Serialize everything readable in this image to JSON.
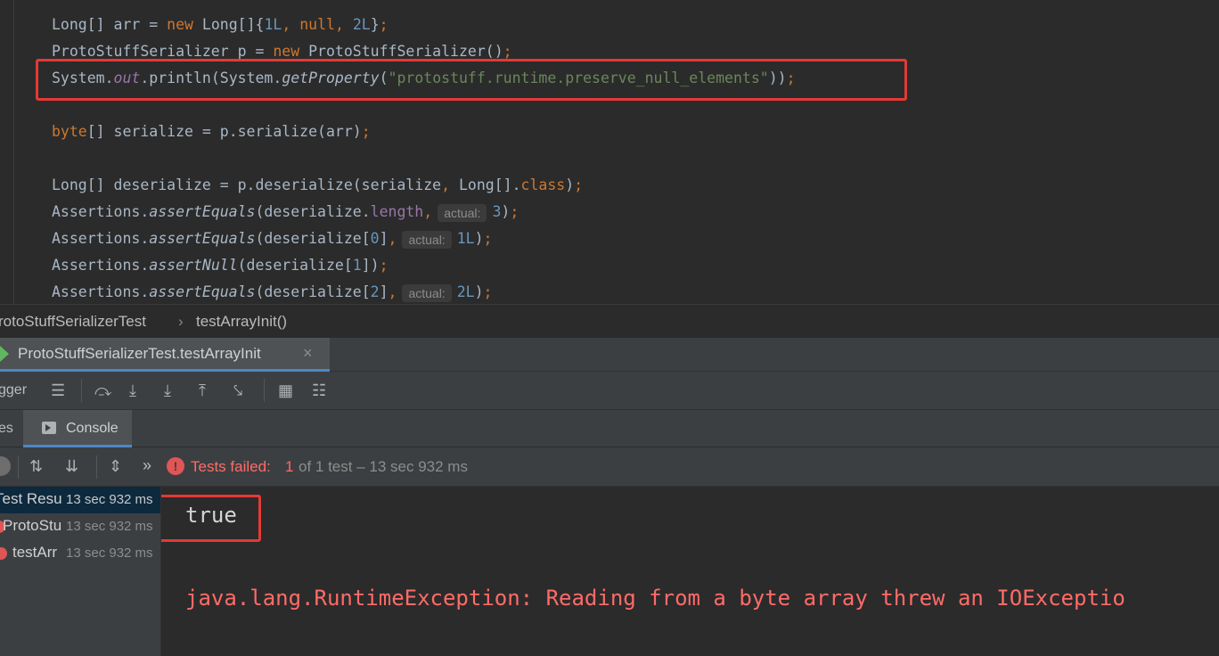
{
  "editor": {
    "lines": [
      {
        "tokens": [
          {
            "t": "Long",
            "c": ""
          },
          {
            "t": "[] arr = ",
            "c": ""
          },
          {
            "t": "new ",
            "c": "kw"
          },
          {
            "t": "Long",
            "c": ""
          },
          {
            "t": "[]{",
            "c": ""
          },
          {
            "t": "1L",
            "c": "num"
          },
          {
            "t": ", ",
            "c": "kw"
          },
          {
            "t": "null",
            "c": "kw"
          },
          {
            "t": ", ",
            "c": "kw"
          },
          {
            "t": "2L",
            "c": "num"
          },
          {
            "t": "}",
            "c": ""
          },
          {
            "t": ";",
            "c": "kw"
          }
        ]
      },
      {
        "tokens": [
          {
            "t": "ProtoStuffSerializer p = ",
            "c": ""
          },
          {
            "t": "new ",
            "c": "kw"
          },
          {
            "t": "ProtoStuffSerializer()",
            "c": ""
          },
          {
            "t": ";",
            "c": "kw"
          }
        ]
      },
      {
        "tokens": [
          {
            "t": "System.",
            "c": ""
          },
          {
            "t": "out",
            "c": "fld"
          },
          {
            "t": ".println(System.",
            "c": ""
          },
          {
            "t": "getProperty",
            "c": "mth"
          },
          {
            "t": "(",
            "c": ""
          },
          {
            "t": "\"protostuff.runtime.preserve_null_elements\"",
            "c": "str"
          },
          {
            "t": "))",
            "c": ""
          },
          {
            "t": ";",
            "c": "kw"
          }
        ]
      },
      {
        "tokens": []
      },
      {
        "tokens": [
          {
            "t": "byte",
            "c": "kw"
          },
          {
            "t": "[] serialize = p.serialize(arr)",
            "c": ""
          },
          {
            "t": ";",
            "c": "kw"
          }
        ]
      },
      {
        "tokens": []
      },
      {
        "tokens": [
          {
            "t": "Long[] deserialize = p.deserialize(serialize",
            "c": ""
          },
          {
            "t": ", ",
            "c": "kw"
          },
          {
            "t": "Long[].",
            "c": ""
          },
          {
            "t": "class",
            "c": "kw"
          },
          {
            "t": ")",
            "c": ""
          },
          {
            "t": ";",
            "c": "kw"
          }
        ]
      },
      {
        "tokens": [
          {
            "t": "Assertions.",
            "c": ""
          },
          {
            "t": "assertEquals",
            "c": "mth"
          },
          {
            "t": "(deserialize.",
            "c": ""
          },
          {
            "t": "length",
            "c": "fldp"
          },
          {
            "t": ",",
            "c": "kw"
          },
          {
            "hint": "actual:"
          },
          {
            "t": "3",
            "c": "num"
          },
          {
            "t": ")",
            "c": ""
          },
          {
            "t": ";",
            "c": "kw"
          }
        ]
      },
      {
        "tokens": [
          {
            "t": "Assertions.",
            "c": ""
          },
          {
            "t": "assertEquals",
            "c": "mth"
          },
          {
            "t": "(deserialize[",
            "c": ""
          },
          {
            "t": "0",
            "c": "num"
          },
          {
            "t": "]",
            "c": ""
          },
          {
            "t": ",",
            "c": "kw"
          },
          {
            "hint": "actual:"
          },
          {
            "t": "1L",
            "c": "num"
          },
          {
            "t": ")",
            "c": ""
          },
          {
            "t": ";",
            "c": "kw"
          }
        ]
      },
      {
        "tokens": [
          {
            "t": "Assertions.",
            "c": ""
          },
          {
            "t": "assertNull",
            "c": "mth"
          },
          {
            "t": "(deserialize[",
            "c": ""
          },
          {
            "t": "1",
            "c": "num"
          },
          {
            "t": "])",
            "c": ""
          },
          {
            "t": ";",
            "c": "kw"
          }
        ]
      },
      {
        "tokens": [
          {
            "t": "Assertions.",
            "c": ""
          },
          {
            "t": "assertEquals",
            "c": "mth"
          },
          {
            "t": "(deserialize[",
            "c": ""
          },
          {
            "t": "2",
            "c": "num"
          },
          {
            "t": "]",
            "c": ""
          },
          {
            "t": ",",
            "c": "kw"
          },
          {
            "hint": "actual:"
          },
          {
            "t": "2L",
            "c": "num"
          },
          {
            "t": ")",
            "c": ""
          },
          {
            "t": ";",
            "c": "kw"
          }
        ]
      }
    ]
  },
  "breadcrumb": {
    "class_name": "rotoStuffSerializerTest",
    "separator": "›",
    "method_name": "testArrayInit()"
  },
  "run_tab": {
    "label": "ProtoStuffSerializerTest.testArrayInit",
    "close": "×"
  },
  "debugger": {
    "label": "gger"
  },
  "panel_tabs": {
    "left_partial": "es",
    "console": "Console"
  },
  "status": {
    "prefix": "Tests failed:",
    "failed_count": "1",
    "suffix": "of 1 test – 13 sec 932 ms",
    "chevrons": "»"
  },
  "tree": {
    "items": [
      {
        "label": "Test Resu",
        "time": "13 sec 932 ms"
      },
      {
        "label": "ProtoStu",
        "time": "13 sec 932 ms"
      },
      {
        "label": "testArr",
        "time": "13 sec 932 ms"
      }
    ]
  },
  "console": {
    "output_line": "true",
    "error_line": "java.lang.RuntimeException: Reading from a byte array threw an IOExceptio"
  },
  "colors": {
    "error": "#ff6b68",
    "highlight_box": "#e53935",
    "keyword": "#cc7832",
    "number": "#6897bb",
    "string": "#6a8759"
  }
}
